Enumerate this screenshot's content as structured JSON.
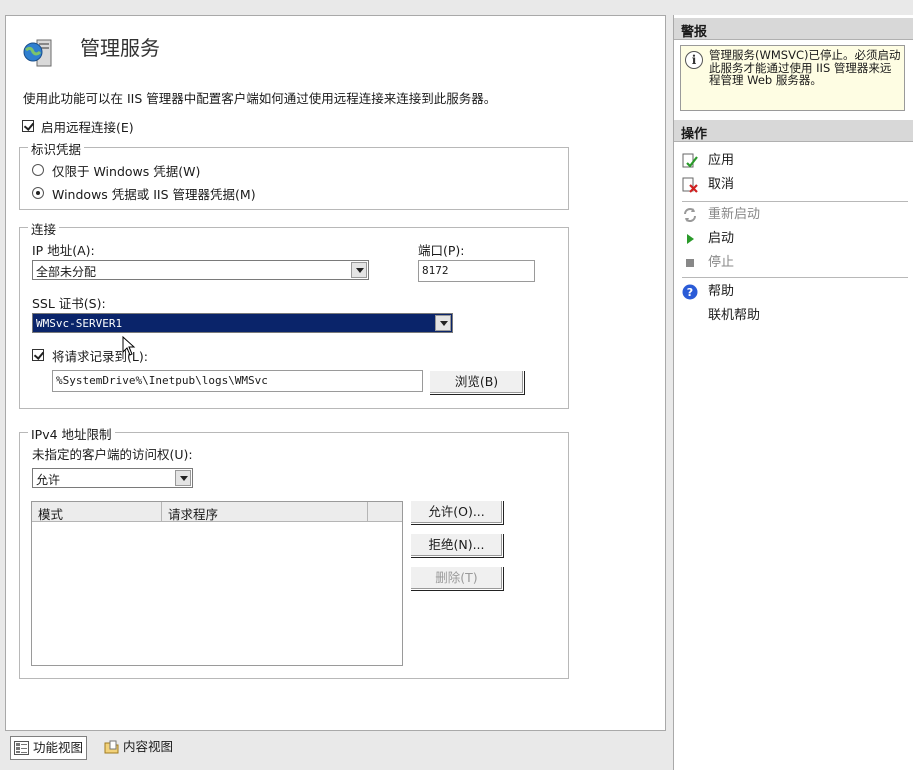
{
  "main": {
    "title": "管理服务",
    "description": "使用此功能可以在 IIS 管理器中配置客户端如何通过使用远程连接来连接到此服务器。",
    "enable_remote": {
      "label": "启用远程连接(E)",
      "checked": true
    },
    "identity": {
      "title": "标识凭据",
      "option1": "仅限于 Windows 凭据(W)",
      "option2": "Windows 凭据或 IIS 管理器凭据(M)",
      "selected": 2
    },
    "connection": {
      "title": "连接",
      "ip_label": "IP 地址(A):",
      "ip_value": "全部未分配",
      "port_label": "端口(P):",
      "port_value": "8172",
      "ssl_label": "SSL 证书(S):",
      "ssl_value": "WMSvc-SERVER1",
      "log_label": "将请求记录到(L):",
      "log_checked": true,
      "log_path": "%SystemDrive%\\Inetpub\\logs\\WMSvc",
      "browse_label": "浏览(B)"
    },
    "ipv4": {
      "title": "IPv4 地址限制",
      "access_label": "未指定的客户端的访问权(U):",
      "access_value": "允许",
      "columns": [
        "模式",
        "请求程序"
      ],
      "allow_button": "允许(O)...",
      "deny_button": "拒绝(N)...",
      "remove_button": "删除(T)"
    }
  },
  "bottom_tabs": {
    "features_view": "功能视图",
    "content_view": "内容视图"
  },
  "right_panel": {
    "alerts_header": "警报",
    "alert_text": "管理服务(WMSVC)已停止。必须启动此服务才能通过使用 IIS 管理器来远程管理 Web 服务器。",
    "actions_header": "操作",
    "actions": {
      "apply": "应用",
      "cancel": "取消",
      "restart": "重新启动",
      "start": "启动",
      "stop": "停止",
      "help": "帮助",
      "online_help": "联机帮助"
    }
  },
  "colors": {
    "selection": "#0a246a",
    "start_green": "#2a9a2a",
    "help_blue": "#2a5bd7"
  }
}
